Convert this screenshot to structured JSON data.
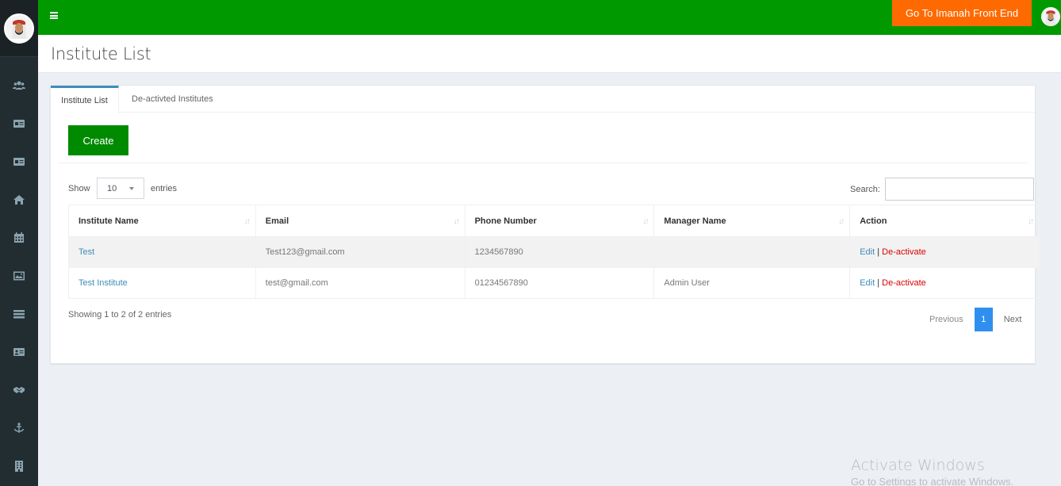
{
  "header": {
    "front_end_button": "Go To Imanah Front End"
  },
  "page": {
    "title": "Institute List"
  },
  "tabs": [
    {
      "label": "Institute List",
      "active": true
    },
    {
      "label": "De-activted Institutes",
      "active": false
    }
  ],
  "create_button": "Create",
  "table_controls": {
    "show_label": "Show",
    "length_value": "10",
    "entries_label": "entries",
    "search_label": "Search:"
  },
  "table": {
    "columns": [
      "Institute Name",
      "Email",
      "Phone Number",
      "Manager Name",
      "Action"
    ],
    "rows": [
      {
        "name": "Test",
        "email": "Test123@gmail.com",
        "phone": "1234567890",
        "manager": "",
        "edit": "Edit",
        "sep": "|",
        "deactivate": "De-activate"
      },
      {
        "name": "Test Institute",
        "email": "test@gmail.com",
        "phone": "01234567890",
        "manager": "Admin User",
        "edit": "Edit",
        "sep": "|",
        "deactivate": "De-activate"
      }
    ]
  },
  "footer": {
    "info": "Showing 1 to 2 of 2 entries",
    "previous": "Previous",
    "page": "1",
    "next": "Next"
  },
  "watermark": {
    "line1": "Activate Windows",
    "line2": "Go to Settings to activate Windows."
  },
  "colors": {
    "header_green": "#009a00",
    "create_green": "#008a00",
    "front_end_orange": "#ff6a00",
    "sidebar": "#222d32",
    "link_blue": "#3c8dbc",
    "deactivate_red": "#dd0000"
  },
  "sidebar_icons": [
    "users-icon",
    "id-card-icon",
    "id-card-alt-icon",
    "home-icon",
    "calendar-icon",
    "image-icon",
    "list-icon",
    "address-card-icon",
    "handshake-icon",
    "anchor-icon",
    "building-icon"
  ]
}
